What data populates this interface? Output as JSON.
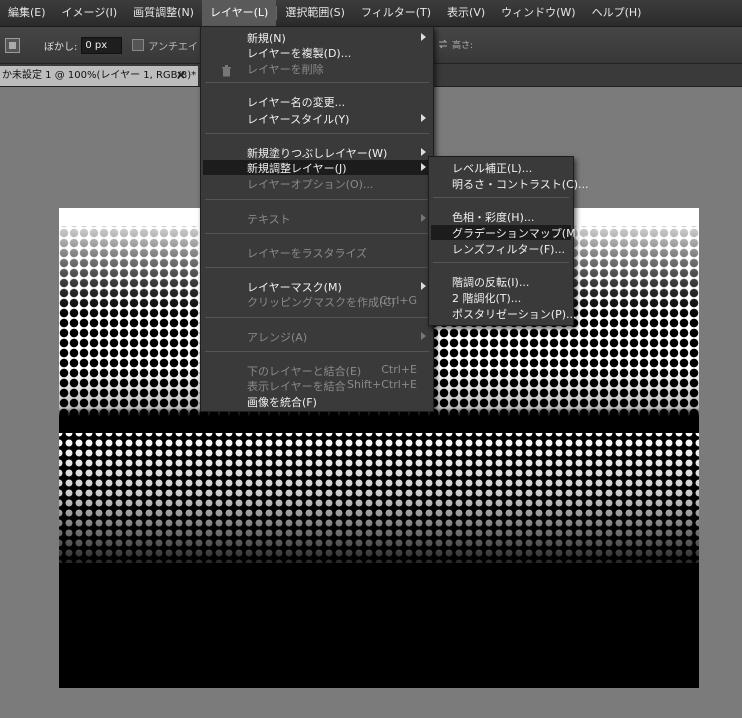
{
  "menubar": {
    "items": [
      {
        "label": "編集(E)"
      },
      {
        "label": "イメージ(I)"
      },
      {
        "label": "画質調整(N)"
      },
      {
        "label": "レイヤー(L)"
      },
      {
        "label": "選択範囲(S)"
      },
      {
        "label": "フィルター(T)"
      },
      {
        "label": "表示(V)"
      },
      {
        "label": "ウィンドウ(W)"
      },
      {
        "label": "ヘルプ(H)"
      }
    ]
  },
  "options_bar": {
    "feather_label": "ぼかし:",
    "feather_value": "0 px",
    "antialias_label": "アンチエイリアス",
    "height_label": "高さ:"
  },
  "document_tab": {
    "title": "か未設定 1 @ 100%(レイヤー 1, RGB/8)*"
  },
  "layer_menu": {
    "new": "新規(N)",
    "duplicate": "レイヤーを複製(D)...",
    "delete": "レイヤーを削除",
    "rename": "レイヤー名の変更...",
    "style": "レイヤースタイル(Y)",
    "new_fill": "新規塗りつぶしレイヤー(W)",
    "new_adjustment": "新規調整レイヤー(J)",
    "layer_options": "レイヤーオプション(O)...",
    "text": "テキスト",
    "rasterize": "レイヤーをラスタライズ",
    "layer_mask": "レイヤーマスク(M)",
    "clipping_mask": "クリッピングマスクを作成(C)",
    "clipping_mask_shortcut": "Ctrl+G",
    "arrange": "アレンジ(A)",
    "merge_down": "下のレイヤーと結合(E)",
    "merge_down_shortcut": "Ctrl+E",
    "merge_visible": "表示レイヤーを結合",
    "merge_visible_shortcut": "Shift+Ctrl+E",
    "flatten": "画像を統合(F)"
  },
  "adjustment_submenu": {
    "levels": "レベル補正(L)...",
    "brightness_contrast": "明るさ・コントラスト(C)...",
    "hue_saturation": "色相・彩度(H)...",
    "gradient_map": "グラデーションマップ(M)...",
    "photo_filter": "レンズフィルター(F)...",
    "invert": "階調の反転(I)...",
    "threshold": "2 階調化(T)...",
    "posterize": "ポスタリゼーション(P)..."
  }
}
